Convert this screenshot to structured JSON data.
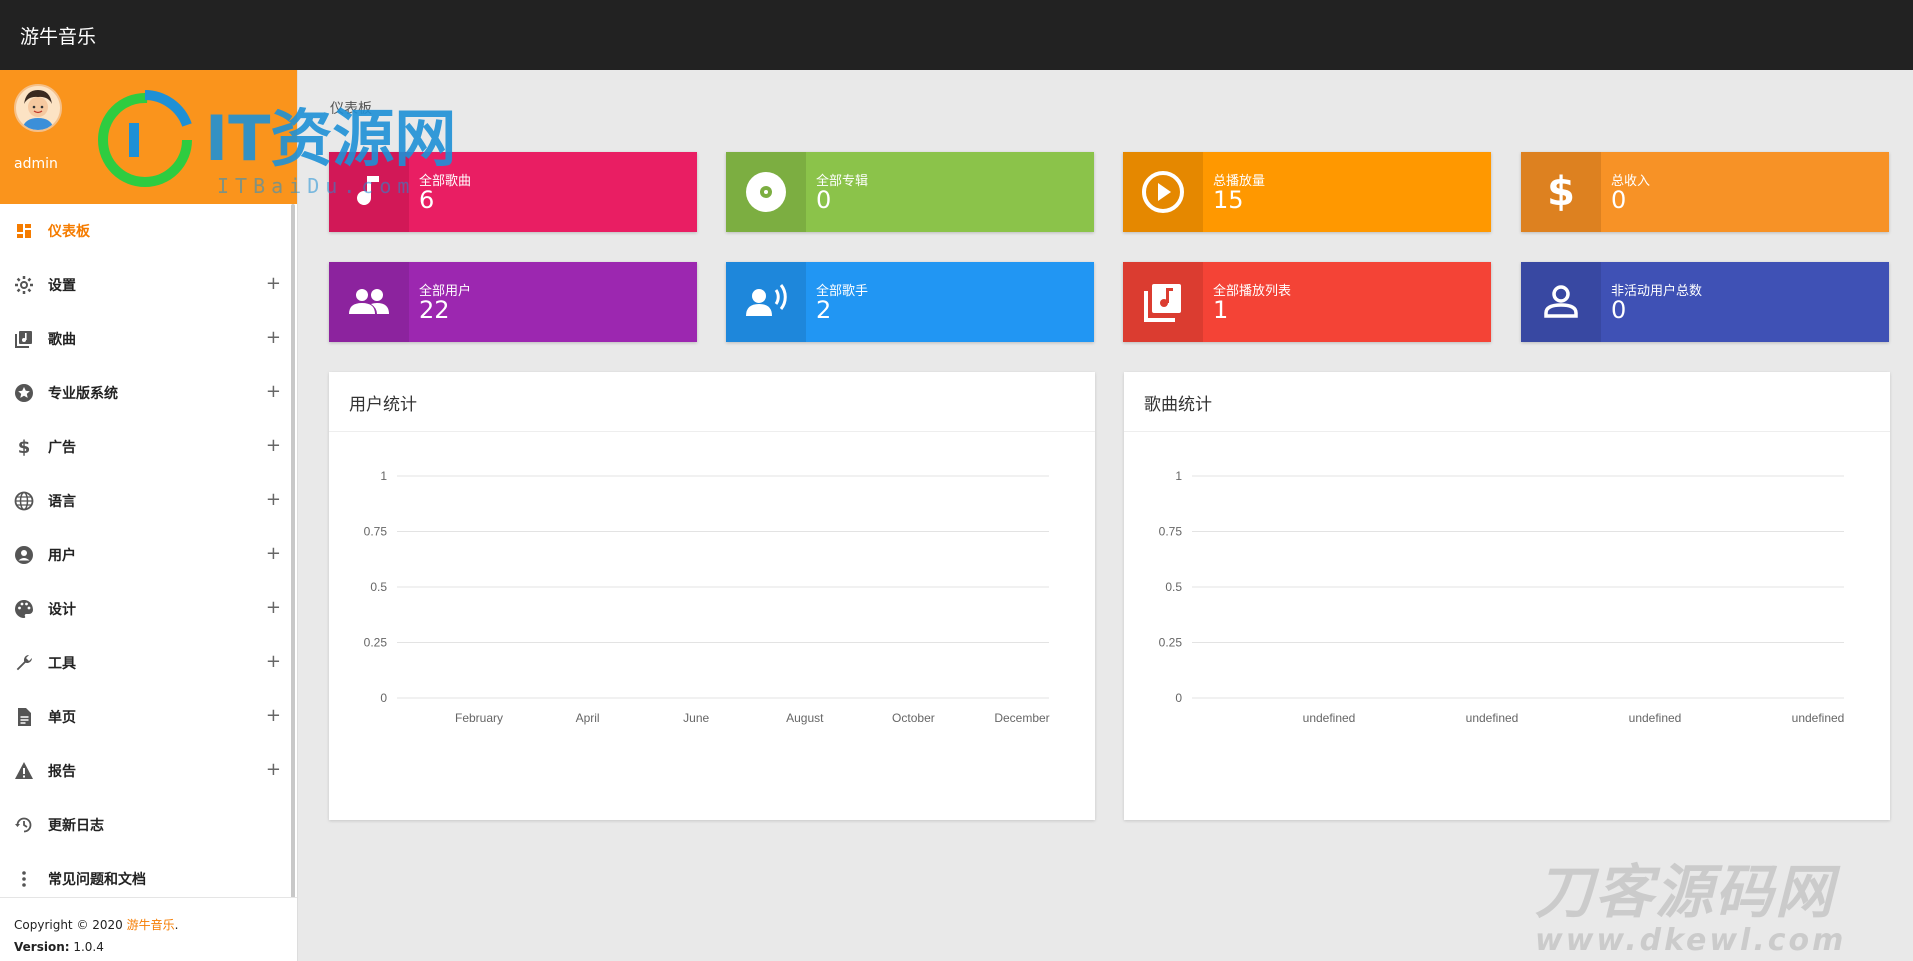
{
  "app": {
    "title": "游牛音乐"
  },
  "user": {
    "name": "admin"
  },
  "breadcrumb": "仪表板",
  "sidebar": {
    "items": [
      {
        "label": "仪表板",
        "icon": "dashboard-icon",
        "active": true,
        "expand": ""
      },
      {
        "label": "设置",
        "icon": "gear-icon",
        "expand": "+"
      },
      {
        "label": "歌曲",
        "icon": "library-music-icon",
        "expand": "+"
      },
      {
        "label": "专业版系统",
        "icon": "star-icon",
        "expand": "+"
      },
      {
        "label": "广告",
        "icon": "dollar-icon",
        "expand": "+"
      },
      {
        "label": "语言",
        "icon": "globe-icon",
        "expand": "+"
      },
      {
        "label": "用户",
        "icon": "user-circle-icon",
        "expand": "+"
      },
      {
        "label": "设计",
        "icon": "palette-icon",
        "expand": "+"
      },
      {
        "label": "工具",
        "icon": "wrench-icon",
        "expand": "+"
      },
      {
        "label": "单页",
        "icon": "document-icon",
        "expand": "+"
      },
      {
        "label": "报告",
        "icon": "warning-icon",
        "expand": "+"
      },
      {
        "label": "更新日志",
        "icon": "history-icon",
        "expand": ""
      },
      {
        "label": "常见问题和文档",
        "icon": "more-vert-icon",
        "expand": ""
      }
    ]
  },
  "footer": {
    "copyright_prefix": "Copyright © 2020 ",
    "copyright_link": "游牛音乐",
    "copyright_suffix": ".",
    "version_label": "Version:",
    "version_value": " 1.0.4"
  },
  "stats": [
    {
      "label": "全部歌曲",
      "value": "6",
      "icon": "music-note-icon",
      "color": "#e91e63",
      "icon_bg": "#d21857"
    },
    {
      "label": "全部专辑",
      "value": "0",
      "icon": "disc-icon",
      "color": "#8bc34a",
      "icon_bg": "#7cae41"
    },
    {
      "label": "总播放量",
      "value": "15",
      "icon": "play-circle-icon",
      "color": "#ff9800",
      "icon_bg": "#e58800"
    },
    {
      "label": "总收入",
      "value": "0",
      "icon": "dollar-icon",
      "color": "#f79226",
      "icon_bg": "#dd8120"
    },
    {
      "label": "全部用户",
      "value": "22",
      "icon": "people-icon",
      "color": "#9c27b0",
      "icon_bg": "#8c239e"
    },
    {
      "label": "全部歌手",
      "value": "2",
      "icon": "speaker-voice-icon",
      "color": "#2196f3",
      "icon_bg": "#1e87db"
    },
    {
      "label": "全部播放列表",
      "value": "1",
      "icon": "library-music-icon",
      "color": "#f44336",
      "icon_bg": "#db3c30"
    },
    {
      "label": "非活动用户总数",
      "value": "0",
      "icon": "person-outline-icon",
      "color": "#3f51b5",
      "icon_bg": "#3848a2"
    }
  ],
  "chart_data": [
    {
      "type": "line",
      "title": "用户统计",
      "categories": [
        "February",
        "April",
        "June",
        "August",
        "October",
        "December"
      ],
      "yticks": [
        "1",
        "0.75",
        "0.5",
        "0.25",
        "0"
      ],
      "ylim": [
        0,
        1
      ],
      "grid": true,
      "series": []
    },
    {
      "type": "line",
      "title": "歌曲统计",
      "categories": [
        "undefined",
        "undefined",
        "undefined",
        "undefined"
      ],
      "yticks": [
        "1",
        "0.75",
        "0.5",
        "0.25",
        "0"
      ],
      "ylim": [
        0,
        1
      ],
      "grid": true,
      "series": []
    }
  ],
  "watermarks": {
    "primary": "IT资源网",
    "primary_sub": "ITBaiDu.com",
    "secondary": "刀客源码网",
    "secondary_sub": "www.dkewl.com"
  },
  "colors": {
    "accent": "#fa941c",
    "topbar": "#222222",
    "active_nav": "#f57c00"
  }
}
